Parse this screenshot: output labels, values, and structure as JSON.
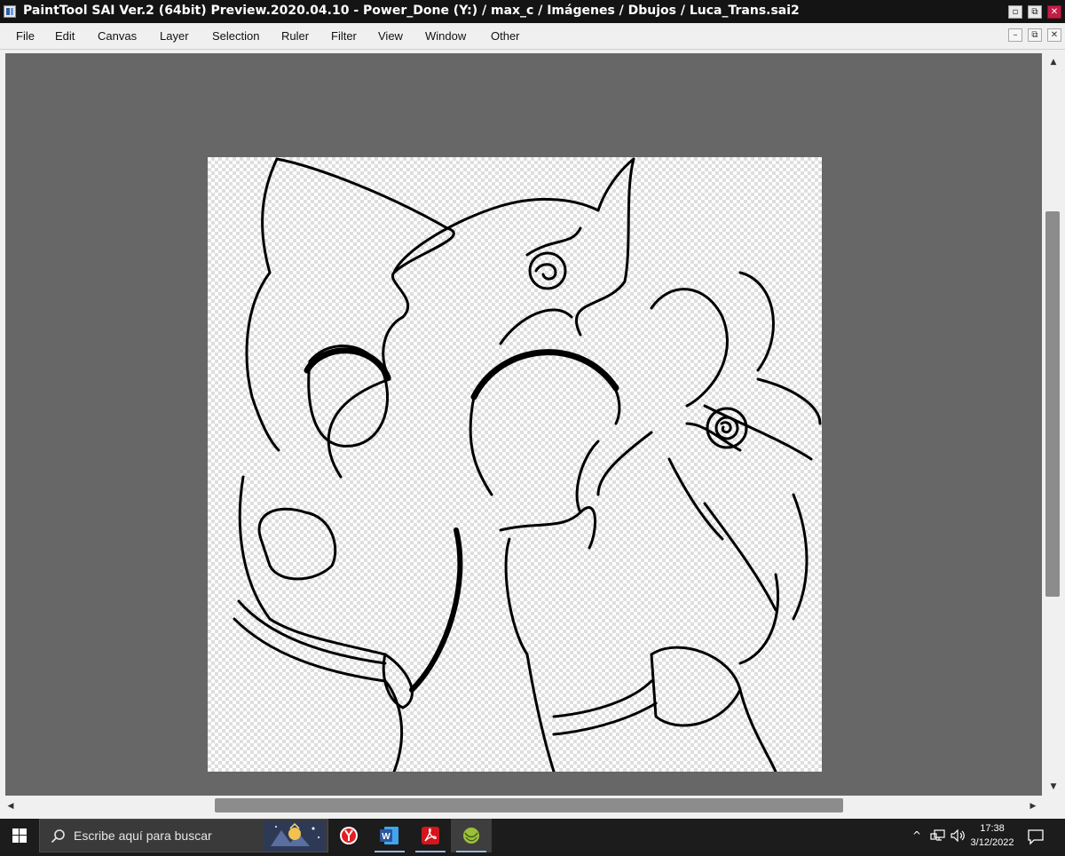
{
  "window": {
    "title": "PaintTool SAI Ver.2 (64bit) Preview.2020.04.10 - Power_Done (Y:) / max_c / Imágenes / Dbujos / Luca_Trans.sai2",
    "minimize_glyph": "▫",
    "restore_glyph": "⧉",
    "close_glyph": "✕",
    "close_color": "#c41d46"
  },
  "menubar": {
    "items": [
      "File",
      "Edit",
      "Canvas",
      "Layer",
      "Selection",
      "Ruler",
      "Filter",
      "View",
      "Window",
      "Other"
    ],
    "mdi_minimize_glyph": "–",
    "mdi_restore_glyph": "⧉",
    "mdi_close_glyph": "✕"
  },
  "canvas": {
    "background": "#676767",
    "artwork": "line-art (transparent background)",
    "scroll_arrows": {
      "up": "▲",
      "down": "▼",
      "left": "◀",
      "right": "▶"
    }
  },
  "taskbar": {
    "search_placeholder": "Escribe aquí para buscar",
    "apps": [
      {
        "name": "Yandex Browser",
        "icon": "yandex-icon",
        "color": "#e31e24"
      },
      {
        "name": "Microsoft Word",
        "icon": "word-icon",
        "color": "#2b579a"
      },
      {
        "name": "Adobe Acrobat",
        "icon": "acrobat-icon",
        "color": "#d4151c"
      },
      {
        "name": "PaintTool SAI",
        "icon": "sai-icon",
        "color": "#9cbf3a"
      }
    ],
    "tray": {
      "chevron": "^",
      "time": "17:38",
      "date": "3/12/2022"
    }
  }
}
